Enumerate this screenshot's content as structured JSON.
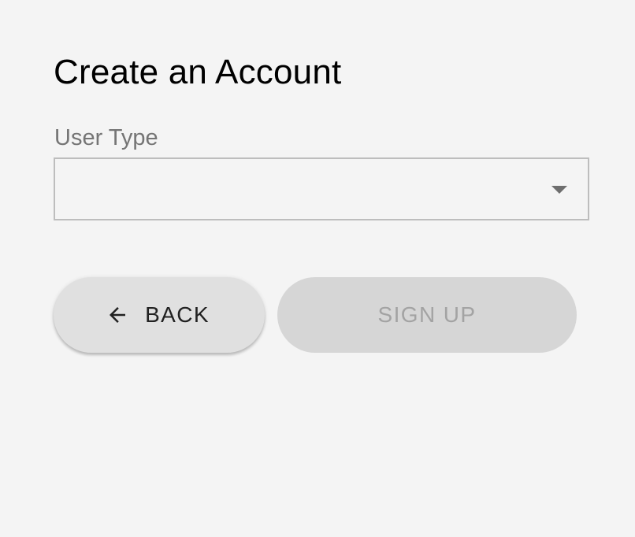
{
  "form": {
    "title": "Create an Account",
    "user_type": {
      "label": "User Type",
      "value": ""
    }
  },
  "actions": {
    "back_label": "BACK",
    "signup_label": "SIGN UP",
    "signup_disabled": true
  },
  "icons": {
    "back": "arrow-left-icon",
    "dropdown": "caret-down-icon"
  },
  "colors": {
    "background": "#f4f4f4",
    "button_bg": "#e0e0e0",
    "disabled_bg": "#d6d6d6",
    "disabled_text": "#a3a3a3",
    "label": "#757575"
  }
}
